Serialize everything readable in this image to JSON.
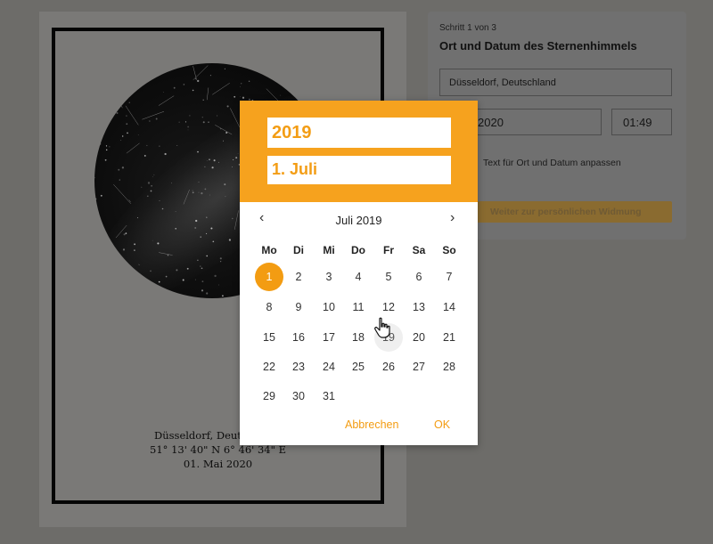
{
  "poster": {
    "caption": [
      "Düsseldorf, Deutschland",
      "51° 13' 40\" N 6° 46' 34\" E",
      "01. Mai 2020"
    ]
  },
  "form": {
    "step": "Schritt 1 von 3",
    "title": "Ort und Datum des Sternenhimmels",
    "location_value": "Düsseldorf, Deutschland",
    "date_value": "2020",
    "time_value": "01:49",
    "adjust_label": "Text für Ort und Datum anpassen",
    "next_button": "Weiter zur persönlichen Widmung"
  },
  "picker": {
    "header_year": "2019",
    "header_date": "1. Juli",
    "month_label": "Juli 2019",
    "prev_icon": "‹",
    "next_icon": "›",
    "weekdays": [
      "Mo",
      "Di",
      "Mi",
      "Do",
      "Fr",
      "Sa",
      "So"
    ],
    "days": [
      "1",
      "2",
      "3",
      "4",
      "5",
      "6",
      "7",
      "8",
      "9",
      "10",
      "11",
      "12",
      "13",
      "14",
      "15",
      "16",
      "17",
      "18",
      "19",
      "20",
      "21",
      "22",
      "23",
      "24",
      "25",
      "26",
      "27",
      "28",
      "29",
      "30",
      "31"
    ],
    "selected_day": 1,
    "hover_day": 19,
    "cancel_label": "Abbrechen",
    "ok_label": "OK"
  },
  "colors": {
    "accent": "#f6a21e",
    "selected": "#f39c12",
    "overlay": "#6d6c69"
  }
}
